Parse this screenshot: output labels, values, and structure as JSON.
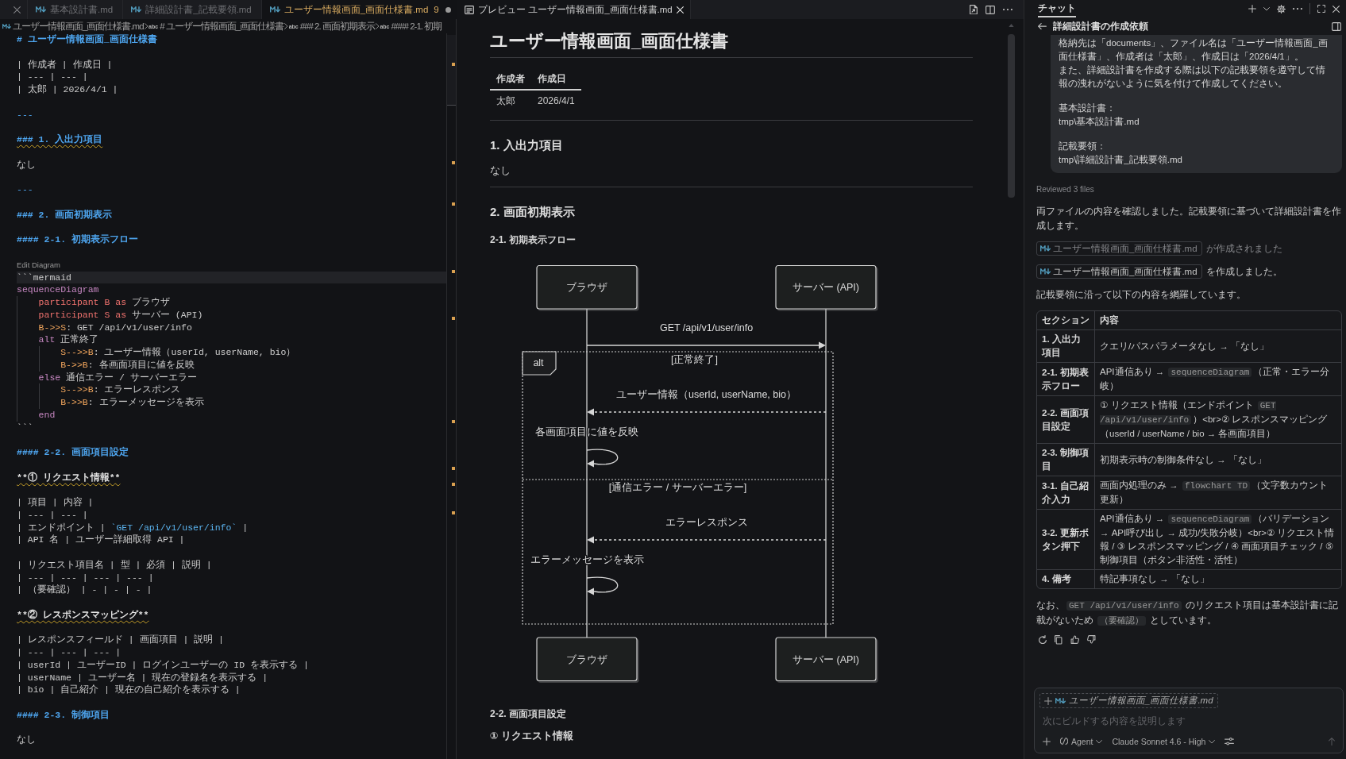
{
  "editor": {
    "tabs": [
      {
        "selected": false,
        "modified": false,
        "close_button": true
      },
      {
        "label": "基本設計書.md",
        "selected": false,
        "modified": false,
        "close_button": false
      },
      {
        "label": "詳細設計書_記載要領.md",
        "selected": false,
        "modified": false,
        "close_button": false
      },
      {
        "label": "ユーザー情報画面_画面仕様書.md",
        "problems": "9",
        "selected": true,
        "modified": true,
        "close_button": false
      }
    ],
    "breadcrumbs": [
      {
        "kind": "file",
        "label": "ユーザー情報画面_画面仕様書.md"
      },
      {
        "kind": "symbol",
        "symbol": "abc",
        "label": "# ユーザー情報画面_画面仕様書"
      },
      {
        "kind": "symbol",
        "symbol": "abc",
        "label": "### 2. 画面初期表示"
      },
      {
        "kind": "symbol",
        "symbol": "abc",
        "label": "#### 2-1. 初期"
      }
    ],
    "blocks": [
      {
        "lines": [
          {
            "tokens": [
              {
                "kind": "heading",
                "text": "# ユーザー情報画面_画面仕様書"
              }
            ],
            "warning": false,
            "current": false
          }
        ]
      },
      {
        "lines": [
          {
            "tokens": [
              {
                "kind": "plain",
                "text": "| 作成者 | 作成日 |"
              }
            ],
            "warning": false,
            "current": false
          },
          {
            "tokens": [
              {
                "kind": "plain",
                "text": "| --- | --- |"
              }
            ],
            "warning": false,
            "current": false
          },
          {
            "tokens": [
              {
                "kind": "plain",
                "text": "| 太郎 | 2026/4/1 |"
              }
            ],
            "warning": false,
            "current": false
          }
        ]
      },
      {
        "lines": [
          {
            "tokens": [
              {
                "kind": "rule",
                "text": "---"
              }
            ],
            "warning": false,
            "current": false
          }
        ]
      },
      {
        "lines": [
          {
            "tokens": [
              {
                "kind": "heading",
                "text": "### 1. 入出力項目"
              }
            ],
            "warning": true,
            "current": false
          }
        ]
      },
      {
        "lines": [
          {
            "tokens": [
              {
                "kind": "plain",
                "text": "なし"
              }
            ],
            "warning": false,
            "current": false
          }
        ]
      },
      {
        "lines": [
          {
            "tokens": [
              {
                "kind": "rule",
                "text": "---"
              }
            ],
            "warning": false,
            "current": false
          }
        ]
      },
      {
        "lines": [
          {
            "tokens": [
              {
                "kind": "heading",
                "text": "### 2. 画面初期表示"
              }
            ],
            "warning": false,
            "current": false
          }
        ]
      },
      {
        "lines": [
          {
            "tokens": [
              {
                "kind": "heading",
                "text": "#### 2-1. 初期表示フロー"
              }
            ],
            "warning": false,
            "current": false
          }
        ]
      },
      {
        "codelens": "Edit Diagram",
        "lines": [
          {
            "tokens": [
              {
                "kind": "fence",
                "text": "```mermaid"
              }
            ],
            "warning": false,
            "current": true
          },
          {
            "tokens": [
              {
                "kind": "control",
                "text": "sequenceDiagram"
              }
            ],
            "warning": false,
            "current": false
          },
          {
            "tokens": [
              {
                "kind": "declaration",
                "text": "    participant B as "
              },
              {
                "kind": "plain",
                "text": "ブラウザ"
              }
            ],
            "warning": false,
            "current": false
          },
          {
            "tokens": [
              {
                "kind": "declaration",
                "text": "    participant S as "
              },
              {
                "kind": "plain",
                "text": "サーバー (API)"
              }
            ],
            "warning": false,
            "current": false
          },
          {
            "tokens": [
              {
                "kind": "arrow",
                "text": "    B->>S"
              },
              {
                "kind": "plain",
                "text": ": GET /api/v1/user/info"
              }
            ],
            "warning": false,
            "current": false
          },
          {
            "tokens": [
              {
                "kind": "control",
                "text": "    alt "
              },
              {
                "kind": "plain",
                "text": "正常終了"
              }
            ],
            "warning": false,
            "current": false
          },
          {
            "tokens": [
              {
                "kind": "arrow",
                "text": "        S-->>B"
              },
              {
                "kind": "plain",
                "text": ": ユーザー情報（userId, userName, bio）"
              }
            ],
            "warning": false,
            "current": false
          },
          {
            "tokens": [
              {
                "kind": "arrow",
                "text": "        B->>B"
              },
              {
                "kind": "plain",
                "text": ": 各画面項目に値を反映"
              }
            ],
            "warning": false,
            "current": false
          },
          {
            "tokens": [
              {
                "kind": "control",
                "text": "    else "
              },
              {
                "kind": "plain",
                "text": "通信エラー / サーバーエラー"
              }
            ],
            "warning": false,
            "current": false
          },
          {
            "tokens": [
              {
                "kind": "arrow",
                "text": "        S-->>B"
              },
              {
                "kind": "plain",
                "text": ": エラーレスポンス"
              }
            ],
            "warning": false,
            "current": false
          },
          {
            "tokens": [
              {
                "kind": "arrow",
                "text": "        B->>B"
              },
              {
                "kind": "plain",
                "text": ": エラーメッセージを表示"
              }
            ],
            "warning": false,
            "current": false
          },
          {
            "tokens": [
              {
                "kind": "control",
                "text": "    end"
              }
            ],
            "warning": false,
            "current": false
          },
          {
            "tokens": [
              {
                "kind": "fence",
                "text": "```"
              }
            ],
            "warning": false,
            "current": false
          }
        ]
      },
      {
        "lines": [
          {
            "tokens": [
              {
                "kind": "heading",
                "text": "#### 2-2. 画面項目設定"
              }
            ],
            "warning": false,
            "current": false
          }
        ]
      },
      {
        "lines": [
          {
            "tokens": [
              {
                "kind": "bold",
                "text": "**① リクエスト情報**"
              }
            ],
            "warning": true,
            "current": false
          }
        ]
      },
      {
        "lines": [
          {
            "tokens": [
              {
                "kind": "plain",
                "text": "| 項目 | 内容 |"
              }
            ],
            "warning": false,
            "current": false
          },
          {
            "tokens": [
              {
                "kind": "plain",
                "text": "| --- | --- |"
              }
            ],
            "warning": false,
            "current": false
          },
          {
            "tokens": [
              {
                "kind": "plain",
                "text": "| エンドポイント | "
              },
              {
                "kind": "code",
                "text": "`GET /api/v1/user/info`"
              },
              {
                "kind": "plain",
                "text": " |"
              }
            ],
            "warning": false,
            "current": false
          },
          {
            "tokens": [
              {
                "kind": "plain",
                "text": "| API 名 | ユーザー詳細取得 API |"
              }
            ],
            "warning": false,
            "current": false
          }
        ]
      },
      {
        "lines": [
          {
            "tokens": [
              {
                "kind": "plain",
                "text": "| リクエスト項目名 | 型 | 必須 | 説明 |"
              }
            ],
            "warning": false,
            "current": false
          },
          {
            "tokens": [
              {
                "kind": "plain",
                "text": "| --- | --- | --- | --- |"
              }
            ],
            "warning": false,
            "current": false
          },
          {
            "tokens": [
              {
                "kind": "plain",
                "text": "| （要確認） | - | - | - |"
              }
            ],
            "warning": false,
            "current": false
          }
        ]
      },
      {
        "lines": [
          {
            "tokens": [
              {
                "kind": "bold",
                "text": "**② レスポンスマッピング**"
              }
            ],
            "warning": true,
            "current": false
          }
        ]
      },
      {
        "lines": [
          {
            "tokens": [
              {
                "kind": "plain",
                "text": "| レスポンスフィールド | 画面項目 | 説明 |"
              }
            ],
            "warning": false,
            "current": false
          },
          {
            "tokens": [
              {
                "kind": "plain",
                "text": "| --- | --- | --- |"
              }
            ],
            "warning": false,
            "current": false
          },
          {
            "tokens": [
              {
                "kind": "plain",
                "text": "| userId | ユーザーID | ログインユーザーの ID を表示する |"
              }
            ],
            "warning": false,
            "current": false
          },
          {
            "tokens": [
              {
                "kind": "plain",
                "text": "| userName | ユーザー名 | 現在の登録名を表示する |"
              }
            ],
            "warning": false,
            "current": false
          },
          {
            "tokens": [
              {
                "kind": "plain",
                "text": "| bio | 自己紹介 | 現在の自己紹介を表示する |"
              }
            ],
            "warning": false,
            "current": false
          }
        ]
      },
      {
        "lines": [
          {
            "tokens": [
              {
                "kind": "heading",
                "text": "#### 2-3. 制御項目"
              }
            ],
            "warning": false,
            "current": false
          }
        ]
      },
      {
        "lines": [
          {
            "tokens": [
              {
                "kind": "plain",
                "text": "なし"
              }
            ],
            "warning": false,
            "current": false
          }
        ]
      }
    ]
  },
  "preview": {
    "tabs": [
      {
        "label": "プレビュー ユーザー情報画面_画面仕様書.md",
        "selected": true,
        "modified": false,
        "close_button": true
      }
    ],
    "blocks": [
      {
        "kind": "h1",
        "text": "ユーザー情報画面_画面仕様書"
      },
      {
        "kind": "table",
        "columns": [
          "作成者",
          "作成日"
        ],
        "rows": [
          [
            "太郎",
            "2026/4/1"
          ]
        ]
      },
      {
        "kind": "hr"
      },
      {
        "kind": "h3",
        "text": "1. 入出力項目"
      },
      {
        "kind": "p",
        "text": "なし"
      },
      {
        "kind": "hr"
      },
      {
        "kind": "h3",
        "text": "2. 画面初期表示"
      },
      {
        "kind": "h4",
        "text": "2-1. 初期表示フロー"
      },
      {
        "kind": "sequence_diagram",
        "participants": [
          {
            "head_label": "ブラウザ",
            "foot_label": "ブラウザ"
          },
          {
            "head_label": "サーバー (API)",
            "foot_label": "サーバー (API)"
          }
        ],
        "steps": [
          {
            "kind": "call",
            "text": "GET /api/v1/user/info"
          },
          {
            "kind": "alt",
            "label": "alt",
            "branches": [
              {
                "condition": "[正常終了]",
                "steps": [
                  {
                    "kind": "reply",
                    "text": "ユーザー情報（userId, userName, bio）"
                  },
                  {
                    "kind": "self_call",
                    "text": "各画面項目に値を反映"
                  }
                ]
              },
              {
                "condition": "[通信エラー / サーバーエラー]",
                "steps": [
                  {
                    "kind": "reply",
                    "text": "エラーレスポンス"
                  },
                  {
                    "kind": "self_call",
                    "text": "エラーメッセージを表示"
                  }
                ]
              }
            ]
          }
        ]
      },
      {
        "kind": "h4",
        "text": "2-2. 画面項目設定"
      },
      {
        "kind": "strong",
        "text": "① リクエスト情報"
      }
    ]
  },
  "chat": {
    "tabs": [
      {
        "label": "チャット",
        "selected": true
      }
    ],
    "title": "詳細設計書の作成依頼",
    "request": [
      [
        "格納先は「documents」、ファイル名は「ユーザー情報画面_画面仕様書」、作成者は「太郎」、作成日は「2026/4/1」。",
        "また、詳細設計書を作成する際は以下の記載要領を遵守して情報の洩れがないように気を付けて作成してください。"
      ],
      [
        "基本設計書：",
        "tmp\\基本設計書.md"
      ],
      [
        "記載要領：",
        "tmp\\詳細設計書_記載要領.md"
      ]
    ],
    "status": "Reviewed 3 files",
    "response": [
      {
        "kind": "paragraph",
        "segments": [
          {
            "kind": "text",
            "text": "両ファイルの内容を確認しました。記載要領に基づいて詳細設計書を作成します。"
          }
        ]
      },
      {
        "kind": "file_note",
        "file": "ユーザー情報画面_画面仕様書.md",
        "text": "が作成されました",
        "dimmed": true
      },
      {
        "kind": "file_note",
        "file": "ユーザー情報画面_画面仕様書.md",
        "text": "を作成しました。",
        "dimmed": false
      },
      {
        "kind": "paragraph",
        "segments": [
          {
            "kind": "text",
            "text": "記載要領に沿って以下の内容を網羅しています。"
          }
        ]
      },
      {
        "kind": "table",
        "columns": [
          "セクション",
          "内容"
        ],
        "rows": [
          {
            "section": "1. 入出力項目",
            "content": [
              {
                "kind": "text",
                "text": "クエリ/パスパラメータなし → 「なし」"
              }
            ]
          },
          {
            "section": "2-1. 初期表示フロー",
            "content": [
              {
                "kind": "text",
                "text": "API通信あり → "
              },
              {
                "kind": "code",
                "text": "sequenceDiagram"
              },
              {
                "kind": "text",
                "text": "（正常・エラー分岐）"
              }
            ]
          },
          {
            "section": "2-2. 画面項目設定",
            "content": [
              {
                "kind": "text",
                "text": "① リクエスト情報（エンドポイント "
              },
              {
                "kind": "code",
                "text": "GET /api/v1/user/info"
              },
              {
                "kind": "text",
                "text": "）<br>② レスポンスマッピング（userId / userName / bio → 各画面項目）"
              }
            ]
          },
          {
            "section": "2-3. 制御項目",
            "content": [
              {
                "kind": "text",
                "text": "初期表示時の制御条件なし → 「なし」"
              }
            ]
          },
          {
            "section": "3-1. 自己紹介入力",
            "content": [
              {
                "kind": "text",
                "text": "画面内処理のみ → "
              },
              {
                "kind": "code",
                "text": "flowchart TD"
              },
              {
                "kind": "text",
                "text": "（文字数カウント更新）"
              }
            ]
          },
          {
            "section": "3-2. 更新ボタン押下",
            "content": [
              {
                "kind": "text",
                "text": "API通信あり → "
              },
              {
                "kind": "code",
                "text": "sequenceDiagram"
              },
              {
                "kind": "text",
                "text": "（バリデーション → API呼び出し → 成功/失敗分岐）<br>② リクエスト情報 / ③ レスポンスマッピング / ④ 画面項目チェック / ⑤ 制御項目（ボタン非活性・活性）"
              }
            ]
          },
          {
            "section": "4. 備考",
            "content": [
              {
                "kind": "text",
                "text": "特記事項なし → 「なし」"
              }
            ]
          }
        ]
      },
      {
        "kind": "paragraph",
        "segments": [
          {
            "kind": "text",
            "text": "なお、"
          },
          {
            "kind": "code",
            "text": "GET /api/v1/user/info"
          },
          {
            "kind": "text",
            "text": " のリクエスト項目は基本設計書に記載がないため "
          },
          {
            "kind": "code",
            "text": "（要確認）"
          },
          {
            "kind": "text",
            "text": " としています。"
          }
        ]
      }
    ],
    "input": {
      "attachment": "ユーザー情報画面_画面仕様書.md",
      "placeholder": "次にビルドする内容を説明します",
      "mode": "Agent",
      "model": "Claude Sonnet 4.6 - High",
      "send_disabled": true
    }
  }
}
